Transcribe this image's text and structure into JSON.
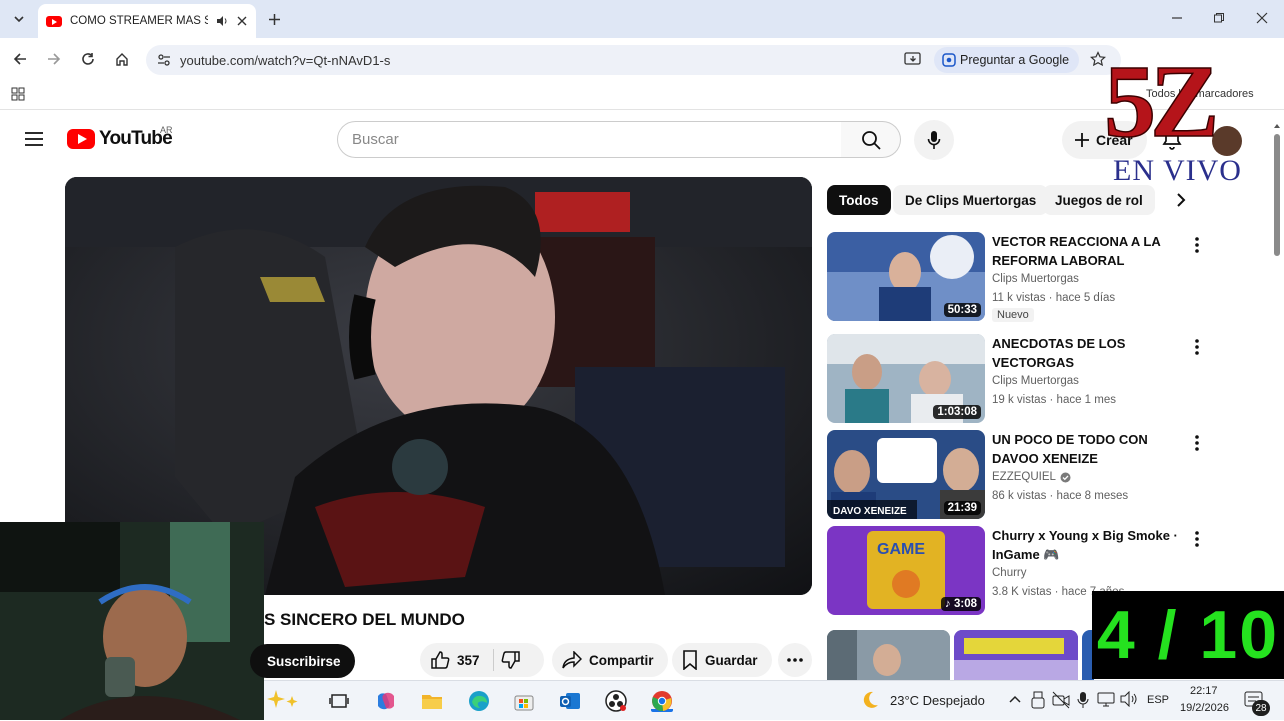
{
  "browser": {
    "tab_title": "COMO STREAMER MAS SIN",
    "url": "youtube.com/watch?v=Qt-nNAvD1-s",
    "ask_google": "Preguntar a Google",
    "bookmarks_label": "Todos los marcadores"
  },
  "youtube": {
    "logo_text": "YouTube",
    "country_code": "AR",
    "search_placeholder": "Buscar",
    "create_label": "Crear",
    "video_title_visible": "S SINCERO DEL MUNDO",
    "subscribe_label": "Suscribirse",
    "like_count": "357",
    "share_label": "Compartir",
    "save_label": "Guardar",
    "chips": [
      "Todos",
      "De Clips Muertorgas",
      "Juegos de rol"
    ],
    "related": [
      {
        "title": "VECTOR REACCIONA A LA REFORMA LABORAL",
        "channel": "Clips Muertorgas",
        "meta": "11 k vistas · hace 5 días",
        "duration": "50:33",
        "badge": "Nuevo",
        "thumb_color": "#3b5fa3"
      },
      {
        "title": "ANECDOTAS DE LOS VECTORGAS",
        "channel": "Clips Muertorgas",
        "meta": "19 k vistas · hace 1 mes",
        "duration": "1:03:08",
        "thumb_color": "#9fb4c4"
      },
      {
        "title": "UN POCO DE TODO CON DAVOO XENEIZE",
        "channel": "EZZEQUIEL",
        "meta": "86 k vistas · hace 8 meses",
        "duration": "21:39",
        "thumb_color": "#2a4c86",
        "thumb_text": "DAVO XENEIZE"
      },
      {
        "title": "Churry x Young x Big Smoke · InGame 🎮",
        "channel": "Churry",
        "meta": "3.8 K vistas · hace 7 años",
        "duration": "3:08",
        "thumb_color": "#7b35c4",
        "thumb_text": "GAME"
      }
    ]
  },
  "overlay": {
    "logo_main": "5Z",
    "logo_sub": "EN VIVO",
    "counter": "4 / 10"
  },
  "taskbar": {
    "weather": "23°C  Despejado",
    "lang": "ESP",
    "time": "22:17",
    "date": "19/2/2026",
    "notifications": "28"
  },
  "colors": {
    "youtube_red": "#ff0000",
    "counter_green": "#25e21f",
    "logo_red": "#b5141a",
    "logo_blue": "#2a2f8c"
  }
}
